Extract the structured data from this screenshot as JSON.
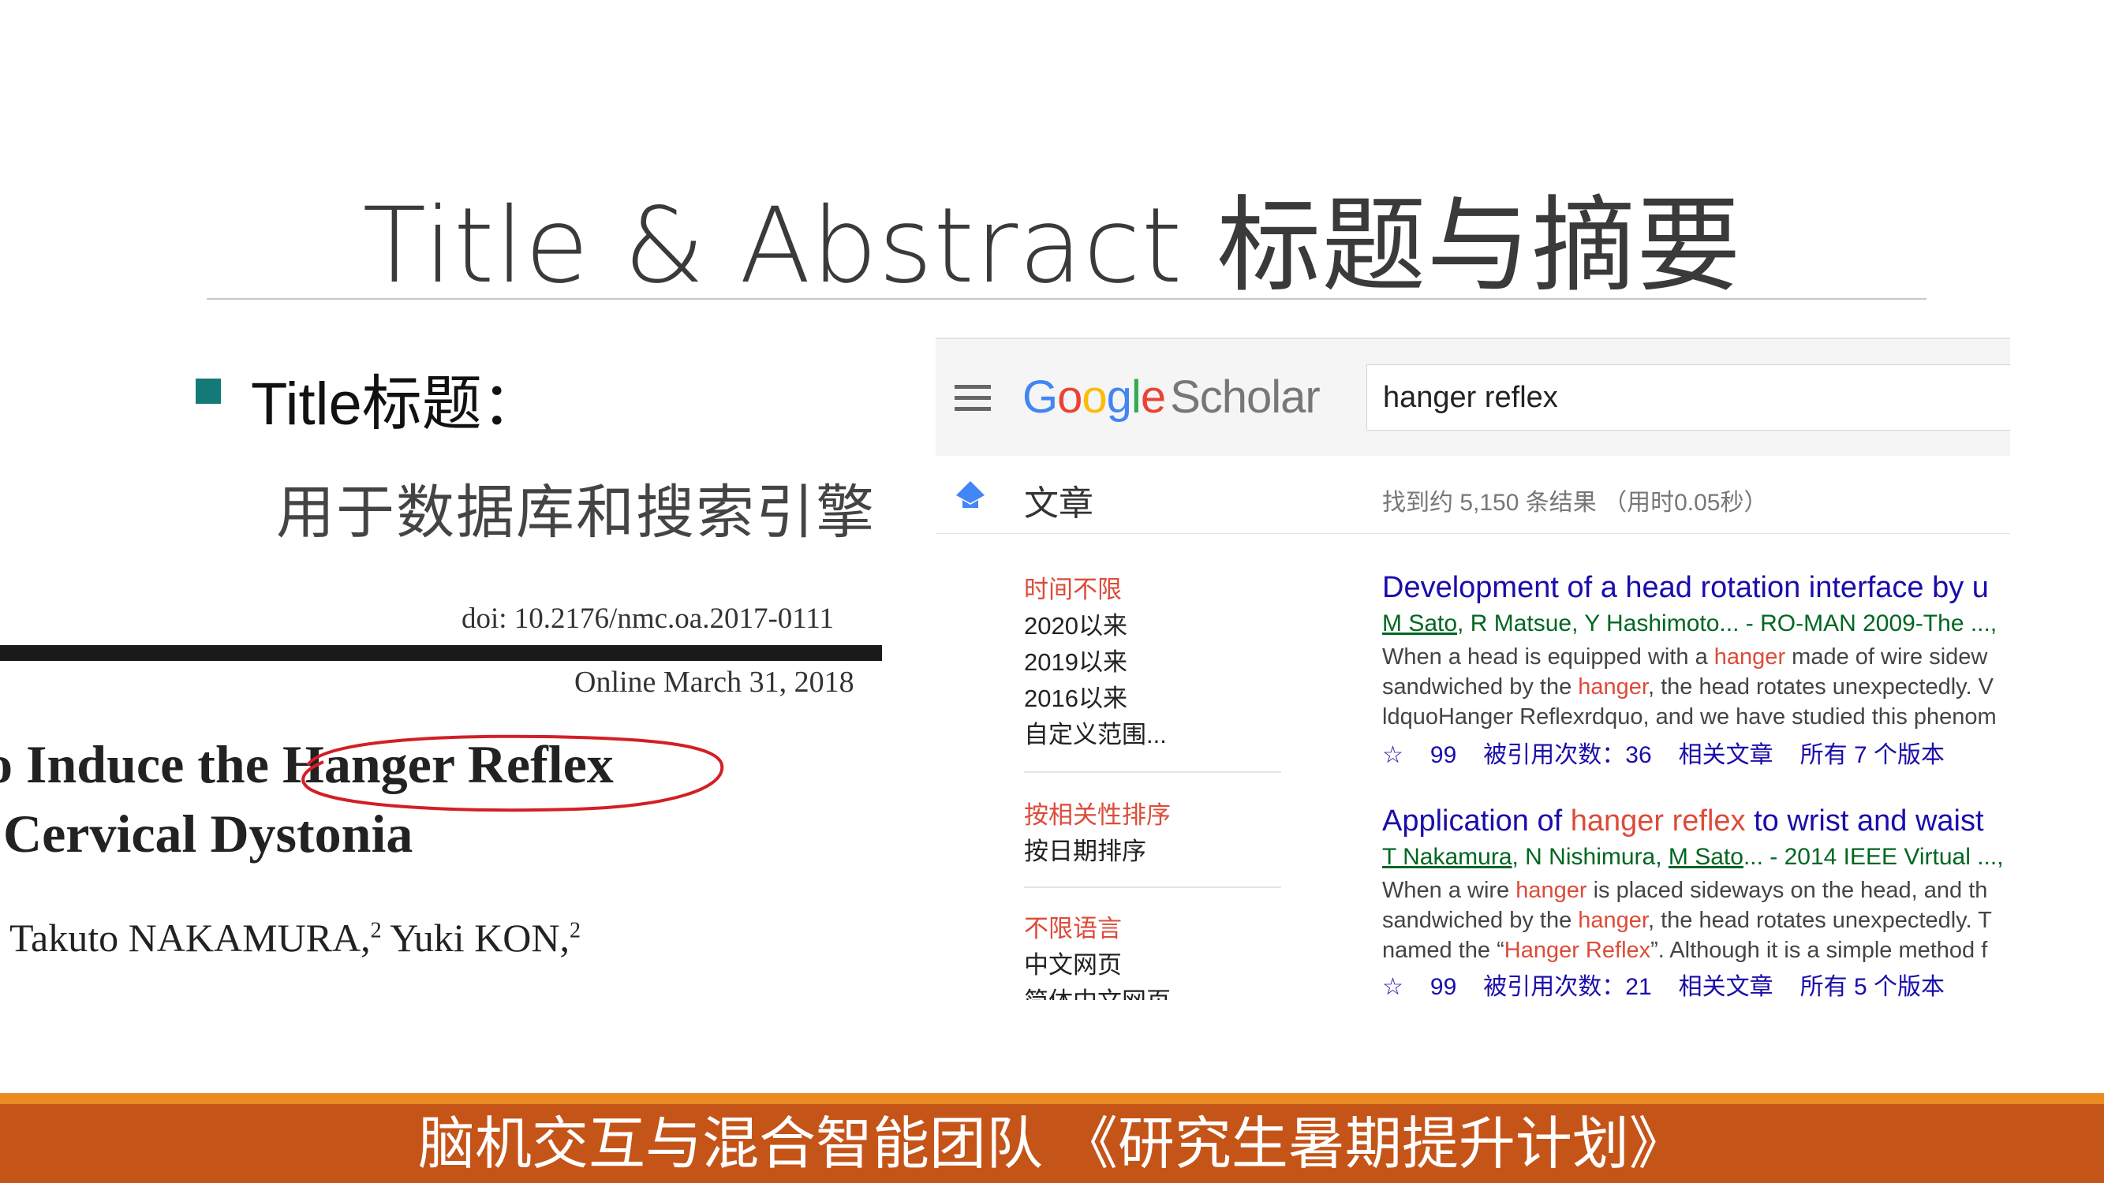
{
  "slide": {
    "title": "Title & Abstract 标题与摘要",
    "bullet_label": "Title标题：",
    "bullet_sub": "用于数据库和搜索引擎"
  },
  "paper": {
    "doi": "doi: 10.2176/nmc.oa.2017-0111",
    "online": "Online March 31, 2018",
    "title_line1_pre": "o Induce the ",
    "title_line1_highlight": "Hanger Reflex",
    "title_line2": "Cervical Dystonia",
    "authors_a": "Takuto NAKAMURA,",
    "authors_sup1": "2",
    "authors_b": " Yuki KON,",
    "authors_sup2": "2"
  },
  "scholar": {
    "logo": {
      "g1": "G",
      "o1": "o",
      "o2": "o",
      "g2": "g",
      "l": "l",
      "e": "e",
      "product": "Scholar"
    },
    "search_value": "hanger reflex",
    "articles_label": "文章",
    "result_count": "找到约 5,150 条结果 （用时0.05秒）",
    "time_filters": [
      "时间不限",
      "2020以来",
      "2019以来",
      "2016以来",
      "自定义范围..."
    ],
    "sort_options": [
      "按相关性排序",
      "按日期排序"
    ],
    "language_options": [
      "不限语言",
      "中文网页",
      "简体中文网页"
    ],
    "results": [
      {
        "title_pre": "Development of a head rotation interface by u",
        "title_hl": "",
        "title_post": "",
        "author1": "M Sato",
        "author_rest": ", R Matsue, Y Hashimoto... - RO-MAN 2009-The ...,",
        "author2": "",
        "venue": "",
        "snip1_pre": "When a head is equipped with a ",
        "snip1_hl": "hanger",
        "snip1_post": " made of wire sidew",
        "snip2_pre": "sandwiched by the ",
        "snip2_hl": "hanger",
        "snip2_post": ", the head rotates unexpectedly. V",
        "snip3": "ldquoHanger Reflexrdquo, and we have studied this phenom",
        "cited": "被引用次数：36",
        "related": "相关文章",
        "versions": "所有 7 个版本"
      },
      {
        "title_pre": "Application of ",
        "title_hl": "hanger reflex",
        "title_post": " to wrist and waist",
        "author1": "T Nakamura",
        "author_rest": ", N Nishimura, ",
        "author2": "M Sato",
        "venue": "... - 2014 IEEE Virtual ...,",
        "snip1_pre": "When a wire ",
        "snip1_hl": "hanger",
        "snip1_post": " is placed sideways on the head, and th",
        "snip2_pre": "sandwiched by the ",
        "snip2_hl": "hanger",
        "snip2_post": ", the head rotates unexpectedly. T",
        "snip3_pre": "named the “",
        "snip3_hl": "Hanger Reflex",
        "snip3_post": "”. Although it is a simple method f",
        "cited": "被引用次数：21",
        "related": "相关文章",
        "versions": "所有 5 个版本"
      }
    ],
    "star_glyph": "☆",
    "cite_glyph": "99"
  },
  "footer": {
    "text": "脑机交互与混合智能团队 《研究生暑期提升计划》"
  },
  "colors": {
    "accent_teal": "#137a77",
    "footer_orange": "#c55419",
    "link_blue": "#1a0dab",
    "highlight_red": "#dd4b39",
    "author_green": "#006621"
  }
}
